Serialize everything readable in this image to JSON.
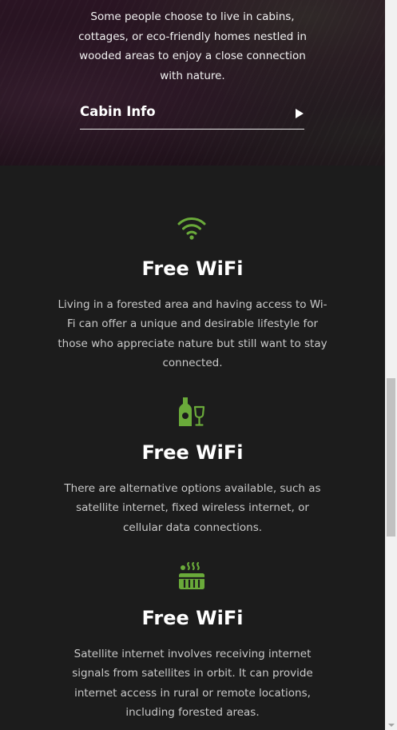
{
  "hero": {
    "description": "Some people choose to live in cabins, cottages, or eco-friendly homes nestled in wooded areas to enjoy a close connection with nature.",
    "cabin_link_label": "Cabin Info"
  },
  "features": [
    {
      "icon": "wifi-icon",
      "title": "Free WiFi",
      "description": "Living in a forested area and having access to Wi-Fi can offer a unique and desirable lifestyle for those who appreciate nature but still want to stay connected."
    },
    {
      "icon": "wine-bottle-glass-icon",
      "title": "Free WiFi",
      "description": "There are alternative options available, such as satellite internet, fixed wireless internet, or cellular data connections."
    },
    {
      "icon": "hot-tub-icon",
      "title": "Free WiFi",
      "description": "Satellite internet involves receiving internet signals from satellites in orbit. It can provide internet access in rural or remote locations, including forested areas."
    }
  ],
  "colors": {
    "accent": "#6aaa3a",
    "background": "#1c1c1c",
    "hero_background": "#24121f"
  }
}
